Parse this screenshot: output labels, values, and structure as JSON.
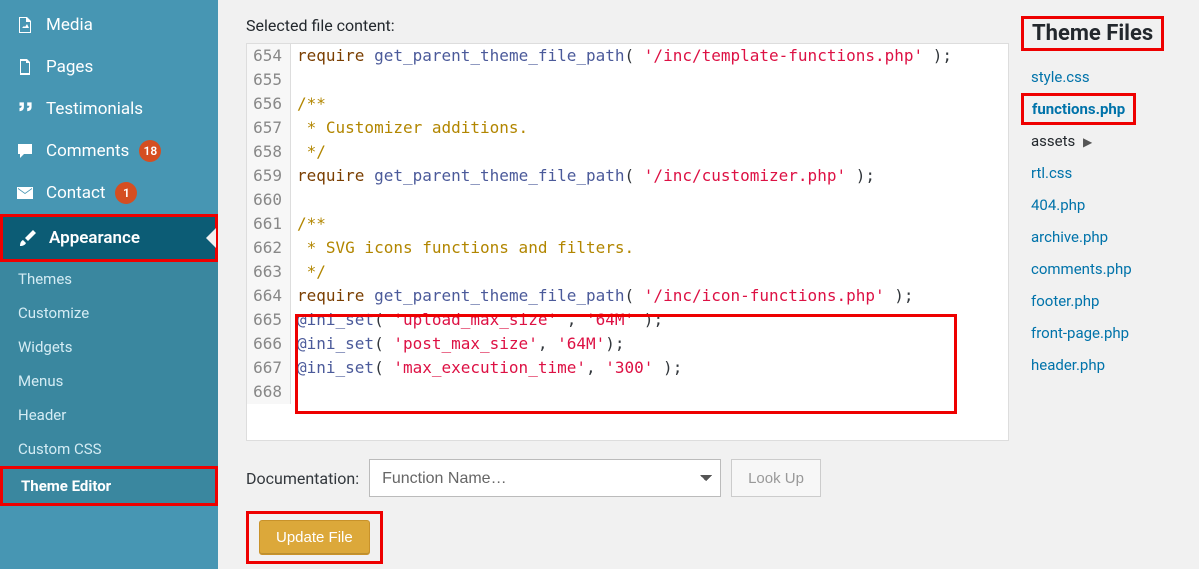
{
  "sidebar": {
    "items": [
      {
        "label": "Media",
        "icon": "media"
      },
      {
        "label": "Pages",
        "icon": "pages"
      },
      {
        "label": "Testimonials",
        "icon": "quote"
      },
      {
        "label": "Comments",
        "icon": "comment",
        "badge": "18"
      },
      {
        "label": "Contact",
        "icon": "mail",
        "badge": "1"
      },
      {
        "label": "Appearance",
        "icon": "brush",
        "active": true
      }
    ],
    "submenu": [
      "Themes",
      "Customize",
      "Widgets",
      "Menus",
      "Header",
      "Custom CSS",
      "Theme Editor"
    ],
    "submenu_current": "Theme Editor"
  },
  "editor": {
    "heading": "Selected file content:",
    "lines": [
      {
        "n": "654",
        "html": "<span class='c-key'>require</span> <span class='c-func'>get_parent_theme_file_path</span>( <span class='c-str'>'/inc/template-functions.php'</span> );"
      },
      {
        "n": "655",
        "html": ""
      },
      {
        "n": "656",
        "html": "<span class='c-comm'>/**</span>"
      },
      {
        "n": "657",
        "html": "<span class='c-comm'> * Customizer additions.</span>"
      },
      {
        "n": "658",
        "html": "<span class='c-comm'> */</span>"
      },
      {
        "n": "659",
        "html": "<span class='c-key'>require</span> <span class='c-func'>get_parent_theme_file_path</span>( <span class='c-str'>'/inc/customizer.php'</span> );"
      },
      {
        "n": "660",
        "html": ""
      },
      {
        "n": "661",
        "html": "<span class='c-comm'>/**</span>"
      },
      {
        "n": "662",
        "html": "<span class='c-comm'> * SVG icons functions and filters.</span>"
      },
      {
        "n": "663",
        "html": "<span class='c-comm'> */</span>"
      },
      {
        "n": "664",
        "html": "<span class='c-key'>require</span> <span class='c-func'>get_parent_theme_file_path</span>( <span class='c-str'>'/inc/icon-functions.php'</span> );"
      },
      {
        "n": "665",
        "html": "<span class='c-func'>@ini_set</span>( <span class='c-str'>'upload_max_size'</span> , <span class='c-str'>'64M'</span> );"
      },
      {
        "n": "666",
        "html": "<span class='c-func'>@ini_set</span>( <span class='c-str'>'post_max_size'</span>, <span class='c-str'>'64M'</span>);"
      },
      {
        "n": "667",
        "html": "<span class='c-func'>@ini_set</span>( <span class='c-str'>'max_execution_time'</span>, <span class='c-str'>'300'</span> );"
      },
      {
        "n": "668",
        "html": ""
      }
    ],
    "doc_label": "Documentation:",
    "doc_placeholder": "Function Name…",
    "lookup": "Look Up",
    "update": "Update File"
  },
  "files": {
    "title": "Theme Files",
    "list": [
      {
        "label": "style.css"
      },
      {
        "label": "functions.php",
        "highlight": true
      },
      {
        "label": "assets",
        "folder": true
      },
      {
        "label": "rtl.css"
      },
      {
        "label": "404.php"
      },
      {
        "label": "archive.php"
      },
      {
        "label": "comments.php"
      },
      {
        "label": "footer.php"
      },
      {
        "label": "front-page.php"
      },
      {
        "label": "header.php"
      }
    ]
  }
}
